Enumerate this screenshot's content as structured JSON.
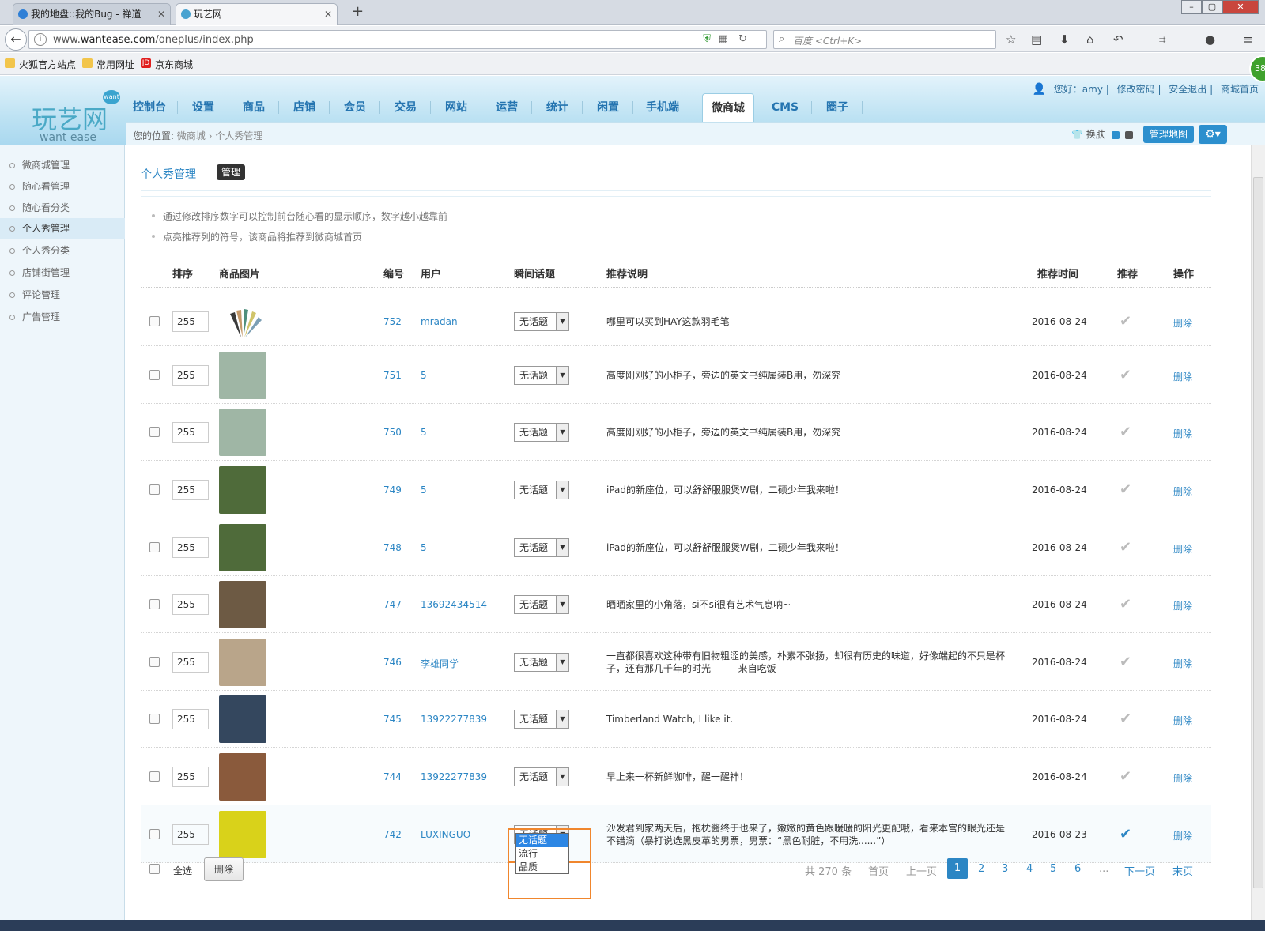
{
  "browser": {
    "tabs": [
      {
        "title": "我的地盘::我的Bug - 禅道"
      },
      {
        "title": "玩艺网"
      }
    ],
    "url_prefix": "www.",
    "url_domain": "wantease.com",
    "url_path": "/oneplus/index.php",
    "search_placeholder": "百度 <Ctrl+K>",
    "bookmarks": [
      "火狐官方站点",
      "常用网址",
      "京东商城"
    ],
    "jd_icon": "JD"
  },
  "site": {
    "logo_cn": "玩艺网",
    "logo_en": "want ease",
    "logo_badge": "want",
    "nav": [
      "控制台",
      "设置",
      "商品",
      "店铺",
      "会员",
      "交易",
      "网站",
      "运营",
      "统计",
      "闲置",
      "手机端",
      "微商城",
      "CMS",
      "圈子"
    ],
    "nav_active": "微商城",
    "user_greeting": "您好：amy",
    "user_links": [
      "修改密码",
      "安全退出",
      "商城首页"
    ],
    "badge_count": "38",
    "breadcrumb_label": "您的位置:",
    "breadcrumb": [
      "微商城",
      "个人秀管理"
    ],
    "skin_label": "换肤",
    "map_button": "管理地图",
    "gear_icon": "gear-icon"
  },
  "sidebar": {
    "items": [
      "微商城管理",
      "随心看管理",
      "随心看分类",
      "个人秀管理",
      "个人秀分类",
      "店铺街管理",
      "评论管理",
      "广告管理"
    ],
    "active": "个人秀管理"
  },
  "main": {
    "title": "个人秀管理",
    "tag": "管理",
    "tips": [
      "通过修改排序数字可以控制前台随心看的显示顺序，数字越小越靠前",
      "点亮推荐列的符号，该商品将推荐到微商城首页"
    ],
    "columns": [
      "排序",
      "商品图片",
      "编号",
      "用户",
      "瞬间话题",
      "推荐说明",
      "推荐时间",
      "推荐",
      "操作"
    ],
    "rows": [
      {
        "sort": "255",
        "id": "752",
        "user": "mradan",
        "topic": "无话题",
        "desc": "哪里可以买到HAY这款羽毛笔",
        "date": "2016-08-24",
        "recommended": false,
        "action": "删除",
        "thumb": "#f1f0ec"
      },
      {
        "sort": "255",
        "id": "751",
        "user": "5",
        "topic": "无话题",
        "desc": "高度刚刚好的小柜子，旁边的英文书纯属装B用，勿深究",
        "date": "2016-08-24",
        "recommended": false,
        "action": "删除",
        "thumb": "#9fb6a5"
      },
      {
        "sort": "255",
        "id": "750",
        "user": "5",
        "topic": "无话题",
        "desc": "高度刚刚好的小柜子，旁边的英文书纯属装B用，勿深究",
        "date": "2016-08-24",
        "recommended": false,
        "action": "删除",
        "thumb": "#9fb6a5"
      },
      {
        "sort": "255",
        "id": "749",
        "user": "5",
        "topic": "无话题",
        "desc": "iPad的新座位，可以舒舒服服煲W剧，二硕少年我来啦！",
        "date": "2016-08-24",
        "recommended": false,
        "action": "删除",
        "thumb": "#4f6b3a"
      },
      {
        "sort": "255",
        "id": "748",
        "user": "5",
        "topic": "无话题",
        "desc": "iPad的新座位，可以舒舒服服煲W剧，二硕少年我来啦！",
        "date": "2016-08-24",
        "recommended": false,
        "action": "删除",
        "thumb": "#4f6b3a"
      },
      {
        "sort": "255",
        "id": "747",
        "user": "13692434514",
        "topic": "无话题",
        "desc": "晒晒家里的小角落，si不si很有艺术气息呐~",
        "date": "2016-08-24",
        "recommended": false,
        "action": "删除",
        "thumb": "#6d5a44"
      },
      {
        "sort": "255",
        "id": "746",
        "user": "李雄同学",
        "topic": "无话题",
        "desc": "一直都很喜欢这种带有旧物粗涩的美感，朴素不张扬，却很有历史的味道，好像端起的不只是杯子，还有那几千年的时光--------来自吃饭",
        "date": "2016-08-24",
        "recommended": false,
        "action": "删除",
        "thumb": "#b9a58a"
      },
      {
        "sort": "255",
        "id": "745",
        "user": "13922277839",
        "topic": "无话题",
        "desc": "Timberland Watch, I like it.",
        "date": "2016-08-24",
        "recommended": false,
        "action": "删除",
        "thumb": "#34475e"
      },
      {
        "sort": "255",
        "id": "744",
        "user": "13922277839",
        "topic": "无话题",
        "desc": "早上来一杯新鲜咖啡，醒一醒神！",
        "date": "2016-08-24",
        "recommended": false,
        "action": "删除",
        "thumb": "#8a5a3c"
      },
      {
        "sort": "255",
        "id": "742",
        "user": "LUXINGUO",
        "topic": "无话题",
        "desc": "沙发君到家两天后，抱枕酱终于也来了，嫩嫩的黄色跟暖暖的阳光更配哦，看来本宫的眼光还是不错滴（暴打说选黑皮革的男票，男票：“黑色耐脏，不用洗......”）",
        "date": "2016-08-23",
        "recommended": true,
        "action": "删除",
        "thumb": "#d9d21a"
      }
    ],
    "dropdown_options": [
      "无话题",
      "流行",
      "品质"
    ],
    "select_all": "全选",
    "delete_button": "删除",
    "pager": {
      "total": "共 270 条",
      "first": "首页",
      "prev": "上一页",
      "pages": [
        "1",
        "2",
        "3",
        "4",
        "5",
        "6"
      ],
      "ellipsis": "...",
      "next": "下一页",
      "last": "末页",
      "current": "1"
    }
  },
  "colors": {
    "accent": "#2c86c4",
    "highlight_box": "#f0862d",
    "header_bg": "#bde2f3"
  }
}
